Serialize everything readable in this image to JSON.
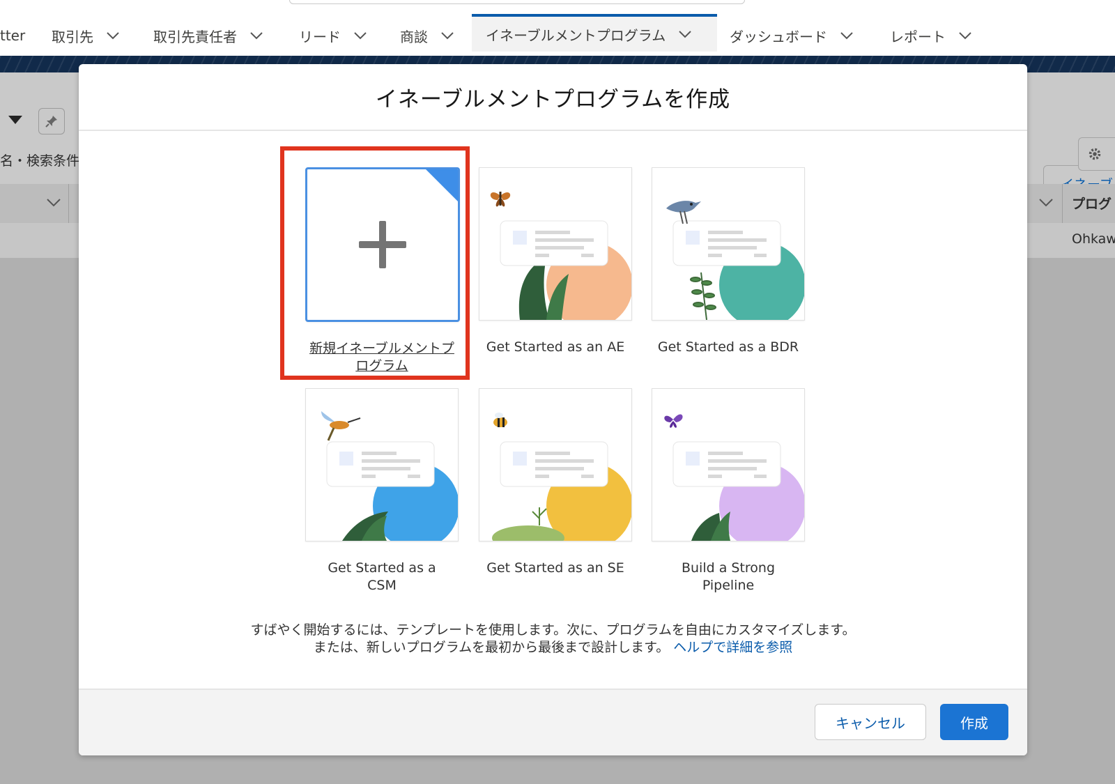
{
  "nav": {
    "items": [
      {
        "label": "tter"
      },
      {
        "label": "取引先"
      },
      {
        "label": "取引先責任者"
      },
      {
        "label": "リード"
      },
      {
        "label": "商談"
      },
      {
        "label": "イネーブルメントプログラム",
        "active": true
      },
      {
        "label": "ダッシュボード"
      },
      {
        "label": "レポート"
      }
    ]
  },
  "background": {
    "list_hint_text": "名・検索条件",
    "right_button_text": "イネーブ",
    "column_header_right": "プログ",
    "cell_right": "Ohkaw"
  },
  "modal": {
    "title": "イネーブルメントプログラムを作成",
    "tiles": [
      {
        "label": "新規イネーブルメントプログラム",
        "icon": "plus-icon",
        "selected": true
      },
      {
        "label": "Get Started as an AE",
        "icon": "moth-illustration",
        "accent": "#f6b98e"
      },
      {
        "label": "Get Started as a BDR",
        "icon": "bird-illustration",
        "accent": "#4db3a4"
      },
      {
        "label": "Get Started as a CSM",
        "icon": "hummingbird-illustration",
        "accent": "#3fa3e8"
      },
      {
        "label": "Get Started as an SE",
        "icon": "bee-illustration",
        "accent": "#f2c03f"
      },
      {
        "label": "Build a Strong Pipeline",
        "icon": "butterfly-illustration",
        "accent": "#d8b6f2"
      }
    ],
    "help_line1": "すばやく開始するには、テンプレートを使用します。次に、プログラムを自由にカスタマイズします。",
    "help_line2": "または、新しいプログラムを最初から最後まで設計します。",
    "help_link": "ヘルプで詳細を参照",
    "cancel_label": "キャンセル",
    "create_label": "作成"
  },
  "colors": {
    "accent_blue": "#1b74d3",
    "selection_red": "#e0341e",
    "brand_band": "#112a4a"
  }
}
